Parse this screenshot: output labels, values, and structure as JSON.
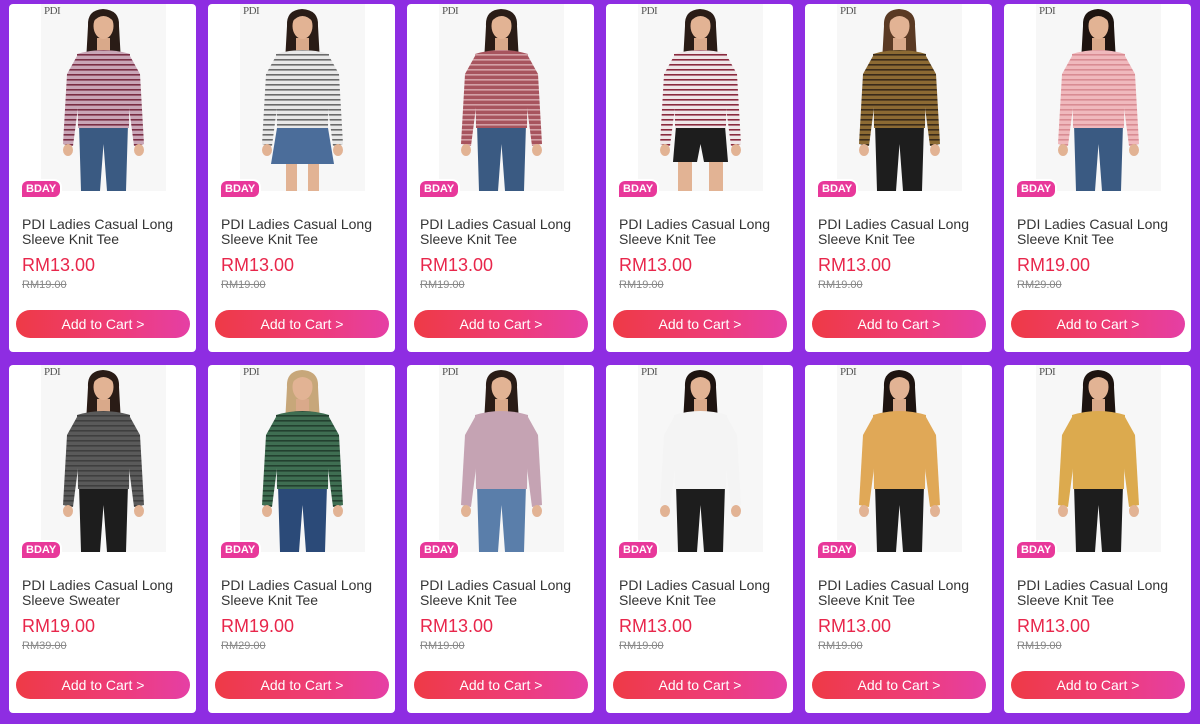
{
  "products": [
    {
      "brand": "PDI",
      "badge": "BDAY",
      "title": "PDI Ladies Casual Long Sleeve Knit Tee",
      "price": "RM13.00",
      "original_price": "RM19.00",
      "cart_label": "Add to Cart >",
      "shirt_color": "#c9a6b7",
      "stripe_color": "#7a2e45",
      "stripes": true,
      "bottom": "jeans",
      "bottom_color": "#3a5a82",
      "hair_color": "#2a1c16"
    },
    {
      "brand": "PDI",
      "badge": "BDAY",
      "title": "PDI Ladies Casual Long Sleeve Knit Tee",
      "price": "RM13.00",
      "original_price": "RM19.00",
      "cart_label": "Add to Cart >",
      "shirt_color": "#e8e8e8",
      "stripe_color": "#6b6b6b",
      "stripes": true,
      "bottom": "skirt",
      "bottom_color": "#4b6d9a",
      "hair_color": "#2a1c16"
    },
    {
      "brand": "PDI",
      "badge": "BDAY",
      "title": "PDI Ladies Casual Long Sleeve Knit Tee",
      "price": "RM13.00",
      "original_price": "RM19.00",
      "cart_label": "Add to Cart >",
      "shirt_color": "#a7545e",
      "stripe_color": "#d3a0a6",
      "stripes": true,
      "bottom": "jeans",
      "bottom_color": "#3a5a82",
      "hair_color": "#2a1c16"
    },
    {
      "brand": "PDI",
      "badge": "BDAY",
      "title": "PDI Ladies Casual Long Sleeve Knit Tee",
      "price": "RM13.00",
      "original_price": "RM19.00",
      "cart_label": "Add to Cart >",
      "shirt_color": "#efe6e8",
      "stripe_color": "#8a2a3e",
      "stripes": true,
      "bottom": "shorts",
      "bottom_color": "#1d1d1d",
      "hair_color": "#2a1c16"
    },
    {
      "brand": "PDI",
      "badge": "BDAY",
      "title": "PDI Ladies Casual Long Sleeve Knit Tee",
      "price": "RM13.00",
      "original_price": "RM19.00",
      "cart_label": "Add to Cart >",
      "shirt_color": "#8c6a33",
      "stripe_color": "#3a2b1a",
      "stripes": true,
      "bottom": "pants",
      "bottom_color": "#1d1d1d",
      "hair_color": "#5a3a24"
    },
    {
      "brand": "PDI",
      "badge": "BDAY",
      "title": "PDI Ladies Casual Long Sleeve Knit Tee",
      "price": "RM19.00",
      "original_price": "RM29.00",
      "cart_label": "Add to Cart >",
      "shirt_color": "#f0b9bd",
      "stripe_color": "#d98c93",
      "stripes": true,
      "bottom": "jeans",
      "bottom_color": "#3a5a82",
      "hair_color": "#1e1410"
    },
    {
      "brand": "PDI",
      "badge": "BDAY",
      "title": "PDI Ladies Casual Long Sleeve Sweater",
      "price": "RM19.00",
      "original_price": "RM39.00",
      "cart_label": "Add to Cart >",
      "shirt_color": "#5a5a5a",
      "stripe_color": "#3f3f3f",
      "stripes": true,
      "bottom": "pants",
      "bottom_color": "#1d1d1d",
      "hair_color": "#2a1c16"
    },
    {
      "brand": "PDI",
      "badge": "BDAY",
      "title": "PDI Ladies Casual Long Sleeve Knit Tee",
      "price": "RM19.00",
      "original_price": "RM29.00",
      "cart_label": "Add to Cart >",
      "shirt_color": "#3f6e52",
      "stripe_color": "#23402f",
      "stripes": true,
      "bottom": "jeans",
      "bottom_color": "#2b4a78",
      "hair_color": "#c7a77a"
    },
    {
      "brand": "PDI",
      "badge": "BDAY",
      "title": "PDI Ladies Casual Long Sleeve Knit Tee",
      "price": "RM13.00",
      "original_price": "RM19.00",
      "cart_label": "Add to Cart >",
      "shirt_color": "#c5a3b3",
      "stripe_color": "#c5a3b3",
      "stripes": false,
      "bottom": "jeans",
      "bottom_color": "#5a7eaa",
      "hair_color": "#2a1c16"
    },
    {
      "brand": "PDI",
      "badge": "BDAY",
      "title": "PDI Ladies Casual Long Sleeve Knit Tee",
      "price": "RM13.00",
      "original_price": "RM19.00",
      "cart_label": "Add to Cart >",
      "shirt_color": "#f4f4f4",
      "stripe_color": "#f4f4f4",
      "stripes": false,
      "bottom": "pants",
      "bottom_color": "#1d1d1d",
      "hair_color": "#1e1410"
    },
    {
      "brand": "PDI",
      "badge": "BDAY",
      "title": "PDI Ladies Casual Long Sleeve Knit Tee",
      "price": "RM13.00",
      "original_price": "RM19.00",
      "cart_label": "Add to Cart >",
      "shirt_color": "#e0a857",
      "stripe_color": "#e0a857",
      "stripes": false,
      "bottom": "pants",
      "bottom_color": "#1d1d1d",
      "hair_color": "#1e1410"
    },
    {
      "brand": "PDI",
      "badge": "BDAY",
      "title": "PDI Ladies Casual Long Sleeve Knit Tee",
      "price": "RM13.00",
      "original_price": "RM19.00",
      "cart_label": "Add to Cart >",
      "shirt_color": "#dcaa4e",
      "stripe_color": "#dcaa4e",
      "stripes": false,
      "bottom": "pants",
      "bottom_color": "#1d1d1d",
      "hair_color": "#1e1410"
    }
  ],
  "colors": {
    "background": "#8e2de2",
    "badge": "#e8389a",
    "price": "#e8264b",
    "cart_gradient_start": "#ee3a46",
    "cart_gradient_end": "#e53fa5"
  }
}
